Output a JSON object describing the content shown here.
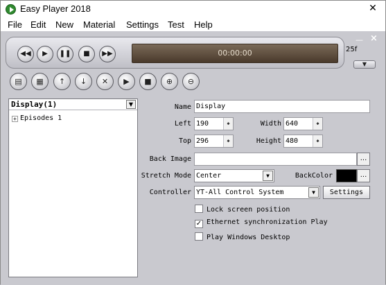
{
  "window": {
    "title": "Easy Player 2018"
  },
  "menu": [
    "File",
    "Edit",
    "New",
    "Material",
    "Settings",
    "Test",
    "Help"
  ],
  "transport": {
    "time": "00:00:00",
    "fps": "25f"
  },
  "tree": {
    "selected": "Display(1)",
    "items": [
      "Episodes 1"
    ]
  },
  "properties": {
    "name_label": "Name",
    "name_value": "Display",
    "left_label": "Left",
    "left_value": "190",
    "width_label": "Width",
    "width_value": "640",
    "top_label": "Top",
    "top_value": "296",
    "height_label": "Height",
    "height_value": "480",
    "back_image_label": "Back Image",
    "back_image_value": "",
    "stretch_label": "Stretch Mode",
    "stretch_value": "Center",
    "backcolor_label": "BackColor",
    "backcolor": "#000000",
    "controller_label": "Controller",
    "controller_value": "YT-All Control System",
    "settings_button": "Settings",
    "browse_button": "..."
  },
  "checkboxes": [
    {
      "label": "Lock screen position",
      "checked": false
    },
    {
      "label": "Ethernet synchronization Play",
      "checked": true
    },
    {
      "label": "Play Windows Desktop",
      "checked": false
    }
  ]
}
